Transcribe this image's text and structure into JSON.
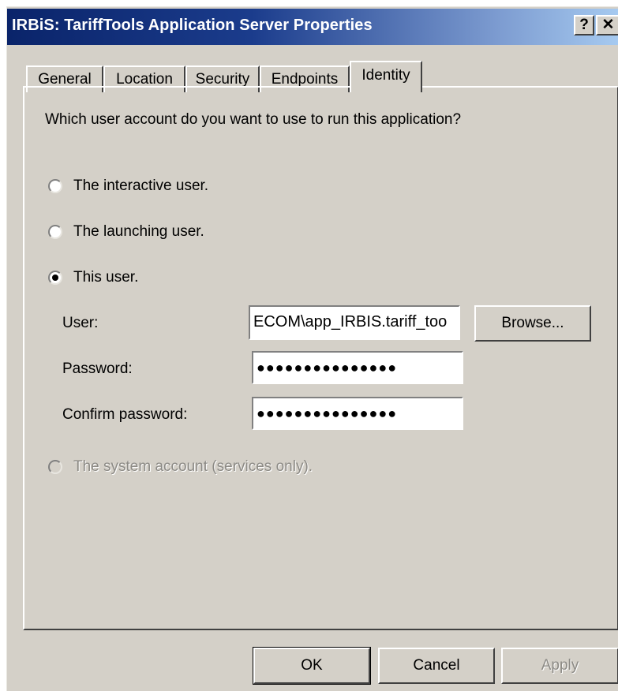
{
  "window": {
    "title": "IRBiS: TariffTools Application Server Properties",
    "help_label": "?",
    "close_label": "✕"
  },
  "tabs": [
    {
      "label": "General",
      "active": false
    },
    {
      "label": "Location",
      "active": false
    },
    {
      "label": "Security",
      "active": false
    },
    {
      "label": "Endpoints",
      "active": false
    },
    {
      "label": "Identity",
      "active": true
    }
  ],
  "identity": {
    "question": "Which user account do you want to use to run this application?",
    "options": [
      {
        "label": "The interactive user.",
        "selected": false,
        "enabled": true
      },
      {
        "label": "The launching user.",
        "selected": false,
        "enabled": true
      },
      {
        "label": "This user.",
        "selected": true,
        "enabled": true
      },
      {
        "label": "The system account (services only).",
        "selected": false,
        "enabled": false
      }
    ],
    "user_label": "User:",
    "user_value": "ECOM\\app_IRBIS.tariff_too",
    "browse_label": "Browse...",
    "password_label": "Password:",
    "password_value": "●●●●●●●●●●●●●●●",
    "confirm_label": "Confirm password:",
    "confirm_value": "●●●●●●●●●●●●●●●"
  },
  "buttons": {
    "ok": "OK",
    "cancel": "Cancel",
    "apply": "Apply"
  },
  "colors": {
    "dialog_face": "#d4d0c8",
    "title_gradient_start": "#0a246a",
    "title_gradient_end": "#a6caf0",
    "disabled_text": "#8c8a85"
  }
}
